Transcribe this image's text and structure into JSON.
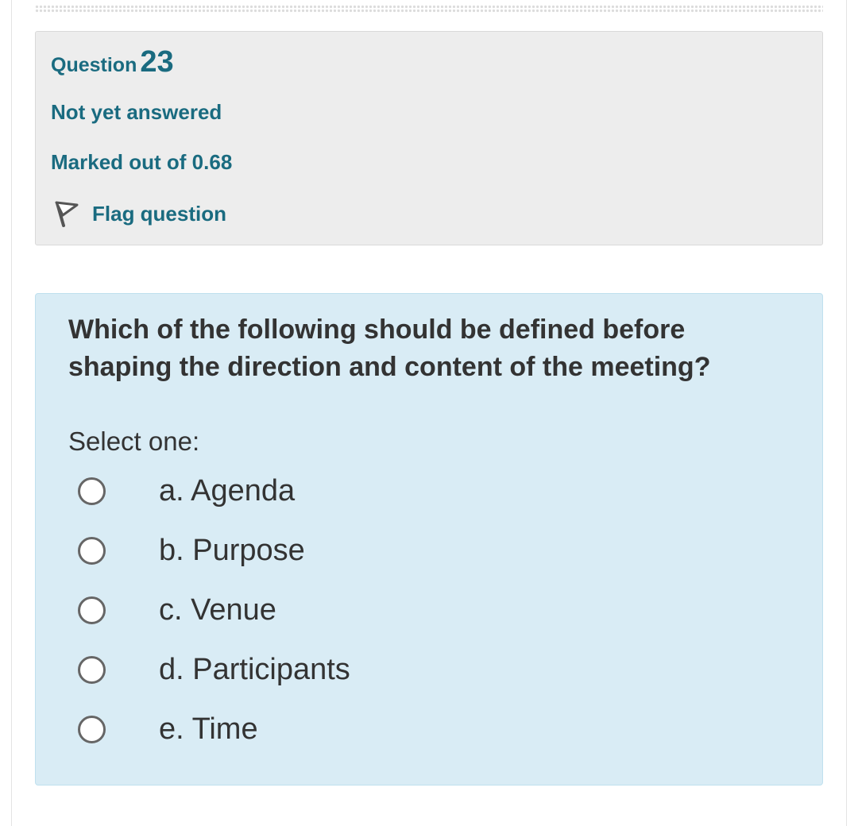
{
  "question_info": {
    "title_prefix": "Question",
    "number": "23",
    "state": "Not yet answered",
    "grade": "Marked out of 0.68",
    "flag_label": "Flag question",
    "flag_icon": "flag-icon"
  },
  "content": {
    "question_text": "Which of the following should be defined before shaping the direction and content of the meeting?",
    "prompt": "Select one:",
    "answers": [
      {
        "label": "a. Agenda",
        "checked": false
      },
      {
        "label": "b. Purpose",
        "checked": false
      },
      {
        "label": "c. Venue",
        "checked": false
      },
      {
        "label": "d. Participants",
        "checked": false
      },
      {
        "label": "e. Time",
        "checked": false
      }
    ]
  },
  "colors": {
    "accent_text": "#1a6b80",
    "info_bg": "#ededed",
    "content_bg": "#d9ecf5",
    "body_text": "#333333"
  }
}
